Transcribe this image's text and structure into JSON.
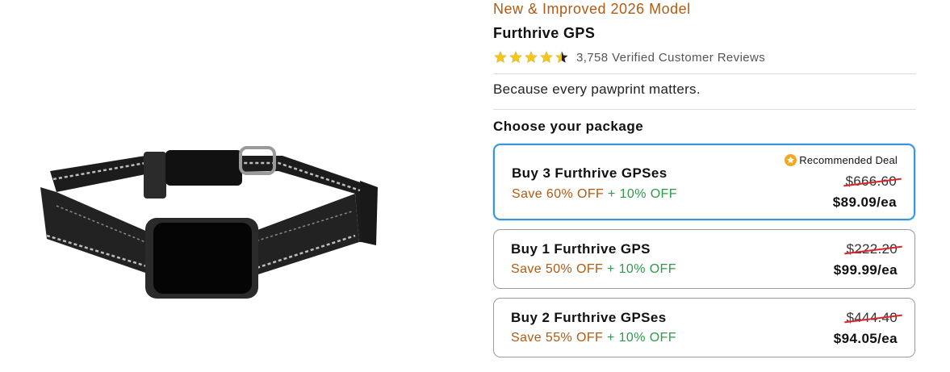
{
  "header": {
    "tagline": "New & Improved 2026 Model",
    "product_title": "Furthrive GPS"
  },
  "rating": {
    "value": 4.5,
    "max": 5,
    "reviews_text": "3,758 Verified Customer Reviews"
  },
  "slogan": "Because every pawprint matters.",
  "packages_section": {
    "heading": "Choose your package",
    "packages": [
      {
        "name": "Buy 3 Furthrive GPSes",
        "save_main": "Save 60% OFF",
        "save_extra": "+ 10% OFF",
        "old_price": "$666.60",
        "price": "$89.09/ea",
        "badge": "Recommended Deal",
        "selected": true
      },
      {
        "name": "Buy 1 Furthrive GPS",
        "save_main": "Save 50% OFF",
        "save_extra": "+ 10% OFF",
        "old_price": "$222.20",
        "price": "$99.99/ea",
        "selected": false
      },
      {
        "name": "Buy 2 Furthrive GPSes",
        "save_main": "Save 55% OFF",
        "save_extra": "+ 10% OFF",
        "old_price": "$444.40",
        "price": "$94.05/ea",
        "selected": false
      }
    ]
  },
  "colors": {
    "accent_orange": "#b25a12",
    "discount_green": "#2e9a4a",
    "selected_border": "#3d95d9",
    "strike_red": "#d8262c",
    "star_gold": "#f5c518"
  },
  "icons": {
    "product_image": "gps-collar-image",
    "rating_star": "star-icon",
    "badge": "star-badge-icon"
  }
}
